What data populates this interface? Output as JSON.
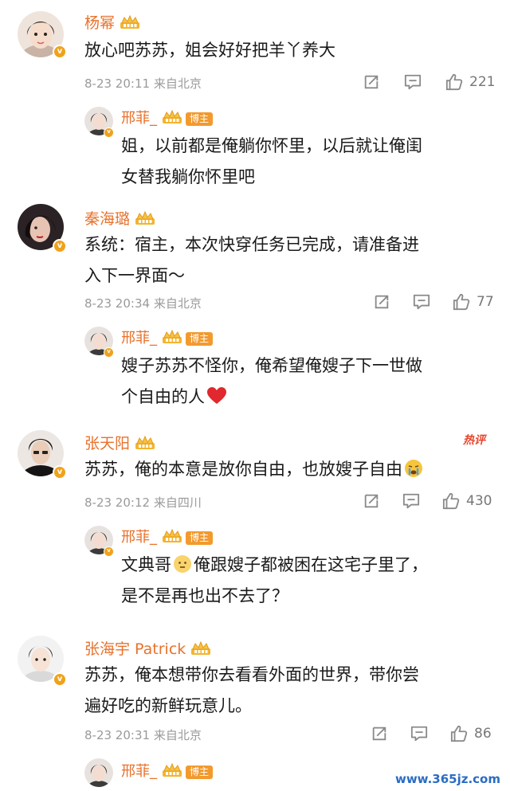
{
  "comments": [
    {
      "user": "杨幂",
      "text_lines": [
        "放心吧苏苏，姐会好好把羊丫养大"
      ],
      "time": "8-23 20:11",
      "source": "来自北京",
      "likes": "221",
      "reply": {
        "user": "邢菲_",
        "badge": "博主",
        "text_lines": [
          "姐，以前都是俺躺你怀里，以后就让俺闺",
          "女替我躺你怀里吧"
        ]
      }
    },
    {
      "user": "秦海璐",
      "text_lines": [
        "系统：宿主，本次快穿任务已完成，请准备进",
        "入下一界面～"
      ],
      "time": "8-23 20:34",
      "source": "来自北京",
      "likes": "77",
      "reply": {
        "user": "邢菲_",
        "badge": "博主",
        "text_lines": [
          "嫂子苏苏不怪你，俺希望俺嫂子下一世做",
          "个自由的人"
        ]
      }
    },
    {
      "user": "张天阳",
      "hot_label": "热评",
      "text_lines": [
        "苏苏，俺的本意是放你自由，也放嫂子自由"
      ],
      "time": "8-23 20:12",
      "source": "来自四川",
      "likes": "430",
      "reply": {
        "user": "邢菲_",
        "badge": "博主",
        "text_lines": [
          "文典哥",
          "俺跟嫂子都被困在这宅子里了，",
          "是不是再也出不去了？"
        ]
      }
    },
    {
      "user": "张海宇 Patrick",
      "text_lines": [
        "苏苏，俺本想带你去看看外面的世界，带你尝",
        "遍好吃的新鲜玩意儿。"
      ],
      "time": "8-23 20:31",
      "source": "来自北京",
      "likes": "86",
      "reply": {
        "user": "邢菲_",
        "badge": "博主"
      }
    }
  ],
  "watermark": "www.365jz.com",
  "colors": {
    "username": "#e8722c",
    "badge": "#f29a2e",
    "meta": "#9a9a9a",
    "heart": "#e0282e"
  }
}
